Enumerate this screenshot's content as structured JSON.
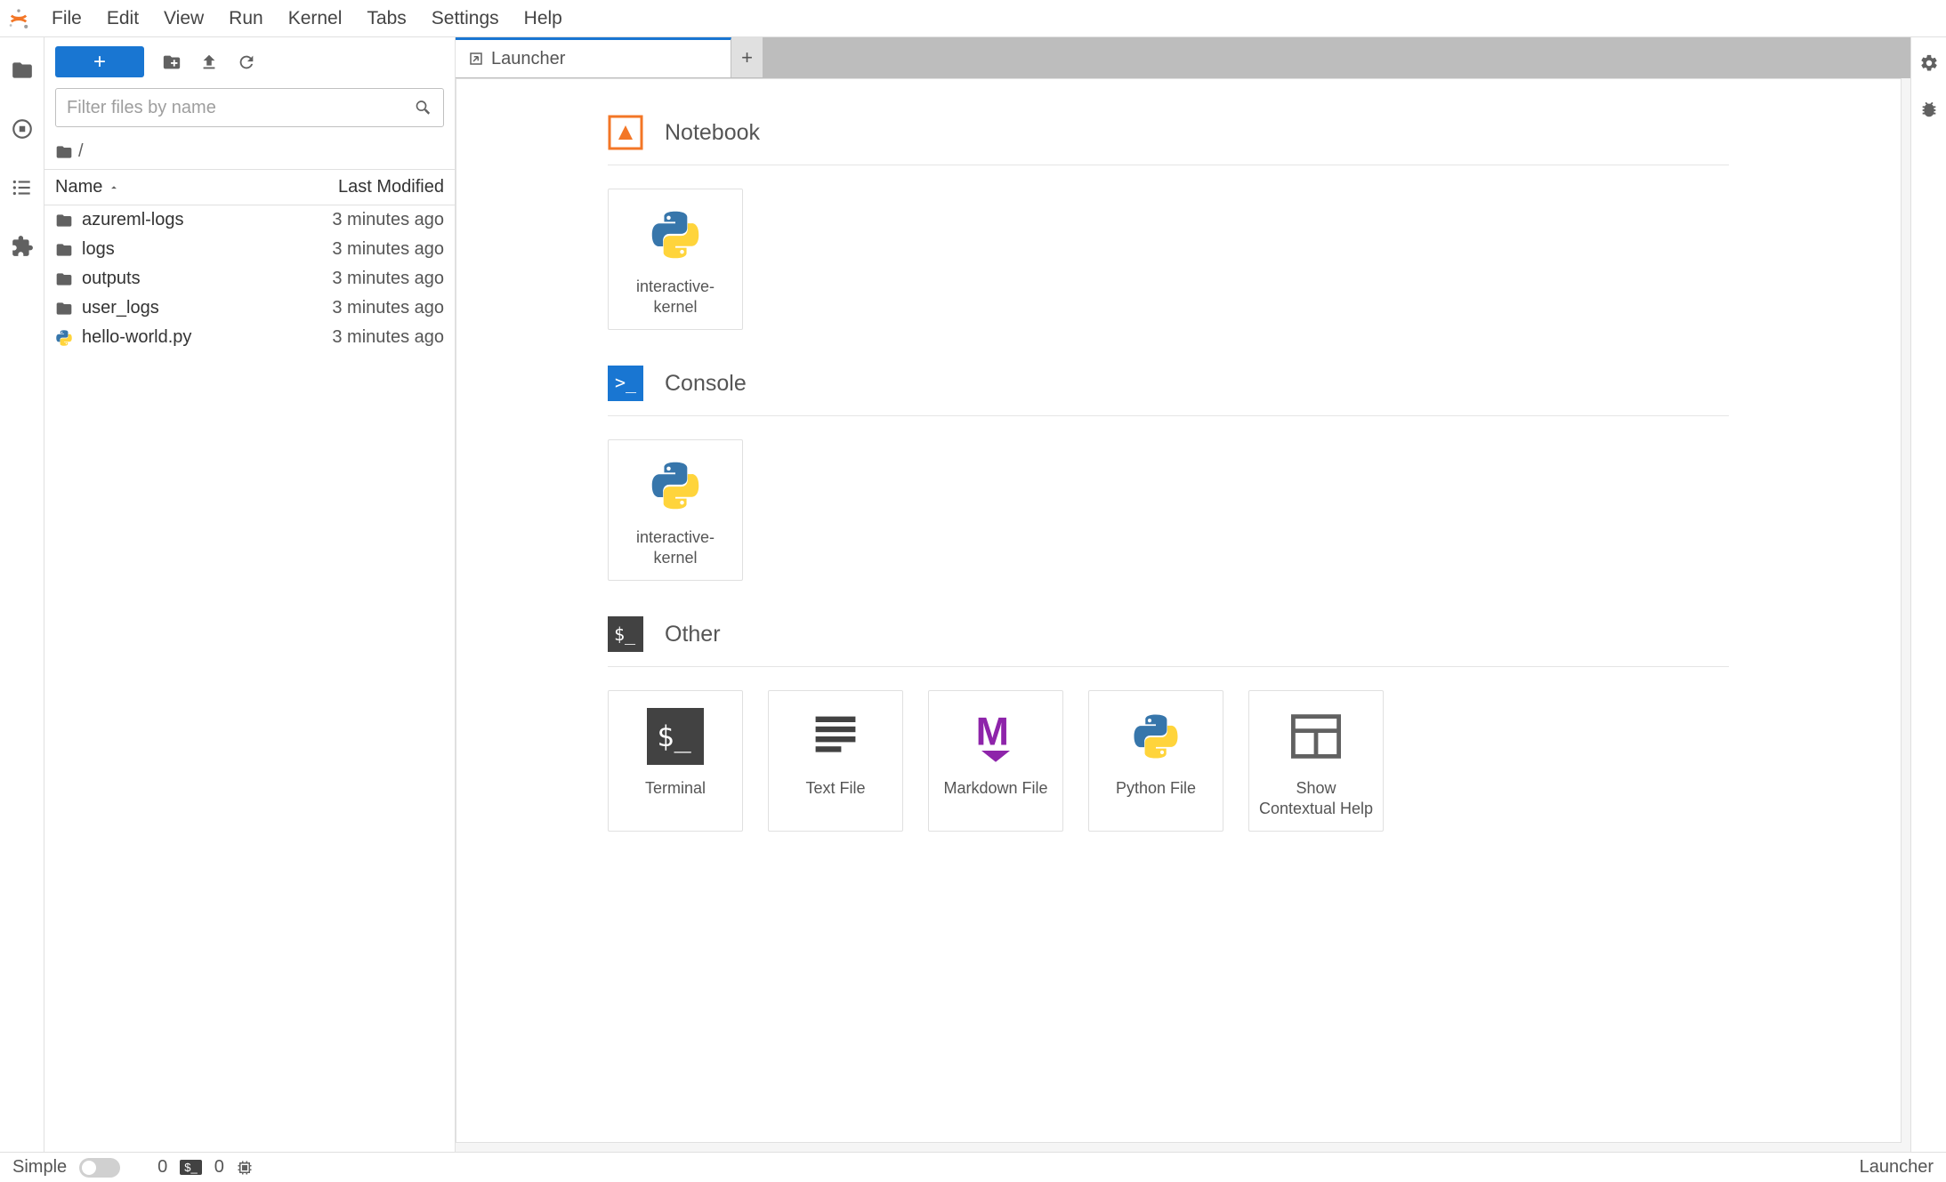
{
  "menu": [
    "File",
    "Edit",
    "View",
    "Run",
    "Kernel",
    "Tabs",
    "Settings",
    "Help"
  ],
  "filebrowser": {
    "filter_placeholder": "Filter files by name",
    "breadcrumb_root": "/",
    "columns": {
      "name": "Name",
      "modified": "Last Modified"
    },
    "items": [
      {
        "name": "azureml-logs",
        "type": "folder",
        "modified": "3 minutes ago"
      },
      {
        "name": "logs",
        "type": "folder",
        "modified": "3 minutes ago"
      },
      {
        "name": "outputs",
        "type": "folder",
        "modified": "3 minutes ago"
      },
      {
        "name": "user_logs",
        "type": "folder",
        "modified": "3 minutes ago"
      },
      {
        "name": "hello-world.py",
        "type": "python",
        "modified": "3 minutes ago"
      }
    ]
  },
  "tab": {
    "title": "Launcher"
  },
  "launcher": {
    "sections": {
      "notebook": {
        "title": "Notebook",
        "cards": [
          {
            "label": "interactive-kernel"
          }
        ]
      },
      "console": {
        "title": "Console",
        "cards": [
          {
            "label": "interactive-kernel"
          }
        ]
      },
      "other": {
        "title": "Other",
        "cards": [
          {
            "label": "Terminal"
          },
          {
            "label": "Text File"
          },
          {
            "label": "Markdown File"
          },
          {
            "label": "Python File"
          },
          {
            "label": "Show Contextual Help"
          }
        ]
      }
    }
  },
  "status": {
    "simple_label": "Simple",
    "terminals": "0",
    "kernels": "0",
    "mode": "Launcher"
  }
}
